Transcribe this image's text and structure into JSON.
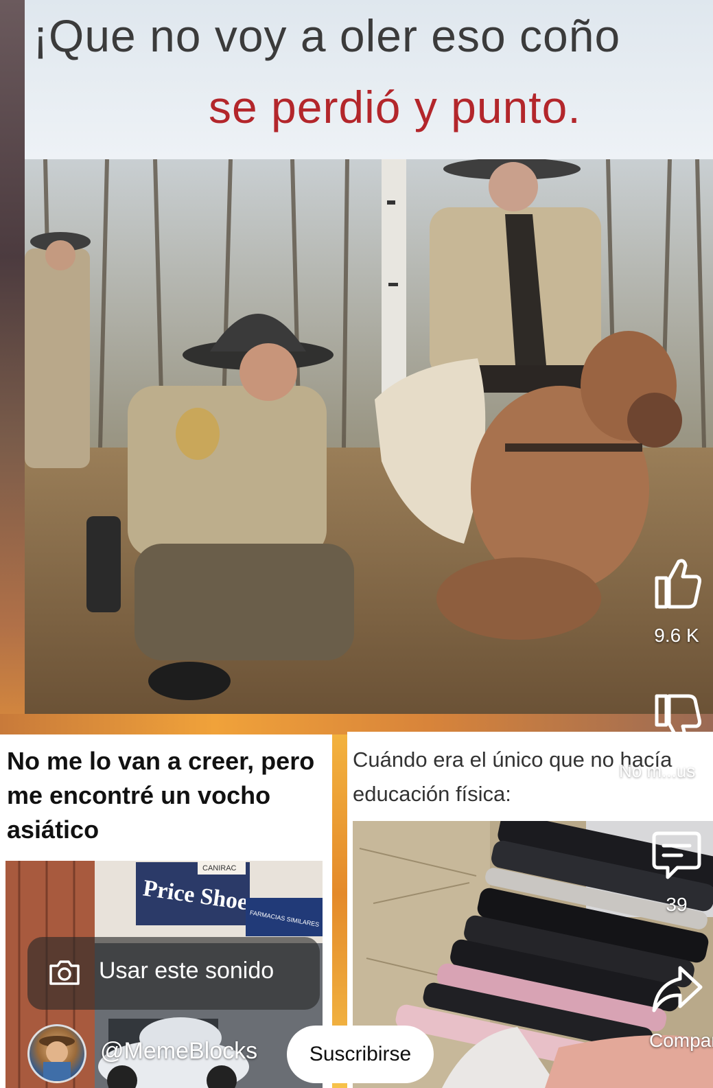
{
  "meme": {
    "caption_line1": "¡Que no voy a oler eso coño",
    "caption_line2": "se perdió y punto."
  },
  "feed": {
    "left_card": {
      "text": "No me lo van a creer, pero me encontré un vocho asiático",
      "signs": [
        "Price Shoes",
        "CANIRAC",
        "FARMACIAS SIMILARES"
      ]
    },
    "right_card": {
      "text": "Cuándo era el único que no hacía educación física:"
    }
  },
  "actions": {
    "like_count": "9.6 K",
    "dislike_label": "No m...us",
    "comment_count": "39",
    "share_label": "Compar"
  },
  "sound": {
    "label": "Usar este sonido",
    "icon": "camera-icon"
  },
  "channel": {
    "handle": "@MemeBlocks",
    "subscribe_label": "Suscribirse"
  },
  "colors": {
    "caption_dark": "#3b3b3b",
    "caption_red": "#b3262b",
    "subscribe_bg": "#ffffff"
  }
}
